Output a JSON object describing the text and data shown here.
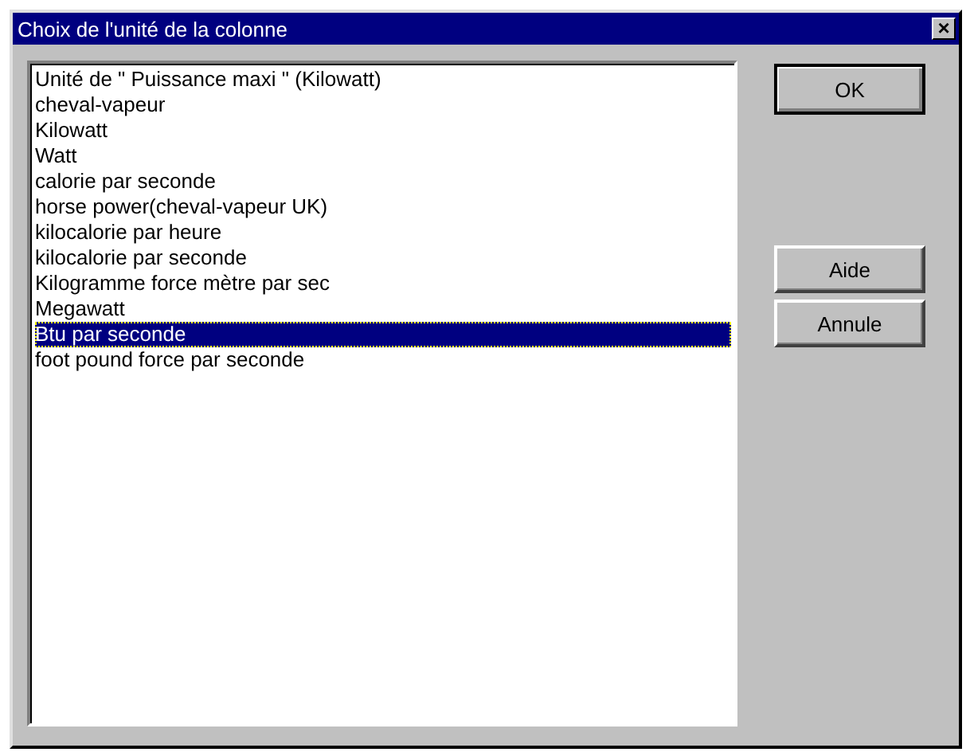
{
  "window": {
    "title": "Choix de l'unité de la colonne",
    "close": "×"
  },
  "list": {
    "items": [
      {
        "label": "Unité de \" Puissance maxi \" (Kilowatt)",
        "selected": false
      },
      {
        "label": "cheval-vapeur",
        "selected": false
      },
      {
        "label": "Kilowatt",
        "selected": false
      },
      {
        "label": "Watt",
        "selected": false
      },
      {
        "label": "calorie par seconde",
        "selected": false
      },
      {
        "label": "horse power(cheval-vapeur UK)",
        "selected": false
      },
      {
        "label": "kilocalorie par heure",
        "selected": false
      },
      {
        "label": "kilocalorie par seconde",
        "selected": false
      },
      {
        "label": "Kilogramme force mètre par sec",
        "selected": false
      },
      {
        "label": "Megawatt",
        "selected": false
      },
      {
        "label": "Btu par seconde",
        "selected": true
      },
      {
        "label": "foot pound force par seconde",
        "selected": false
      }
    ]
  },
  "buttons": [
    {
      "label": "OK",
      "default": true
    },
    {
      "label": "Aide",
      "default": false
    },
    {
      "label": "Annule",
      "default": false
    }
  ]
}
